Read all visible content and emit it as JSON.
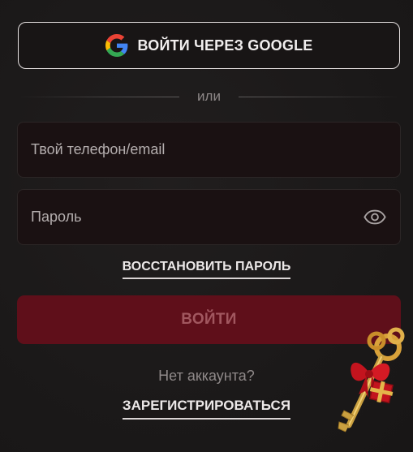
{
  "google_button": {
    "label": "ВОЙТИ ЧЕРЕЗ GOOGLE",
    "icon": "google-g-icon"
  },
  "divider": {
    "text": "или"
  },
  "phone_field": {
    "placeholder": "Твой телефон/email",
    "value": ""
  },
  "password_field": {
    "placeholder": "Пароль",
    "value": "",
    "icon": "eye-icon"
  },
  "restore_link": {
    "label": "ВОССТАНОВИТЬ ПАРОЛЬ"
  },
  "login_button": {
    "label": "ВОЙТИ"
  },
  "no_account": {
    "text": "Нет аккаунта?"
  },
  "register_link": {
    "label": "ЗАРЕГИСТРИРОВАТЬСЯ"
  },
  "decoration": {
    "icon": "gift-key-icon"
  },
  "colors": {
    "background": "#1c1a1a",
    "field_background": "#1a1112",
    "login_button": "#5f0f1a",
    "login_text": "#a1575f",
    "text_primary": "#ece8e8",
    "text_muted": "#8e8888"
  }
}
